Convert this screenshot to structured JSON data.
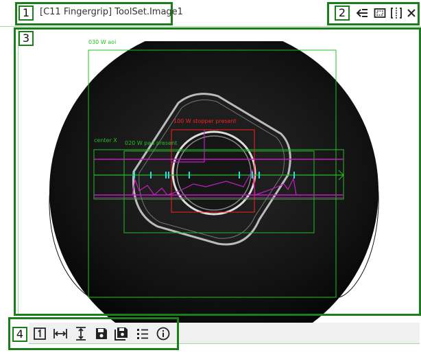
{
  "window": {
    "title": "[C11 Fingergrip] ToolSet.Image1"
  },
  "region_labels": {
    "one": "1",
    "two": "2",
    "three": "3",
    "four": "4"
  },
  "titlebar_icons": [
    {
      "name": "collapse-left-icon"
    },
    {
      "name": "fit-frame-icon"
    },
    {
      "name": "split-view-icon"
    },
    {
      "name": "close-icon"
    }
  ],
  "toolbar_icons": [
    {
      "name": "actual-size-1-icon"
    },
    {
      "name": "fit-width-icon"
    },
    {
      "name": "fit-height-icon"
    },
    {
      "name": "save-icon"
    },
    {
      "name": "save-all-icon"
    },
    {
      "name": "list-icon"
    },
    {
      "name": "info-icon"
    }
  ],
  "overlay_labels": {
    "aoi": "030 W aoi",
    "stopper": "100 W stopper present",
    "center": "center X",
    "pad": "020 W pad present"
  },
  "colors": {
    "frame_green": "#1a7f1a",
    "overlay_green": "#22c022",
    "overlay_red": "#ff2020",
    "overlay_magenta": "#c020c0"
  }
}
